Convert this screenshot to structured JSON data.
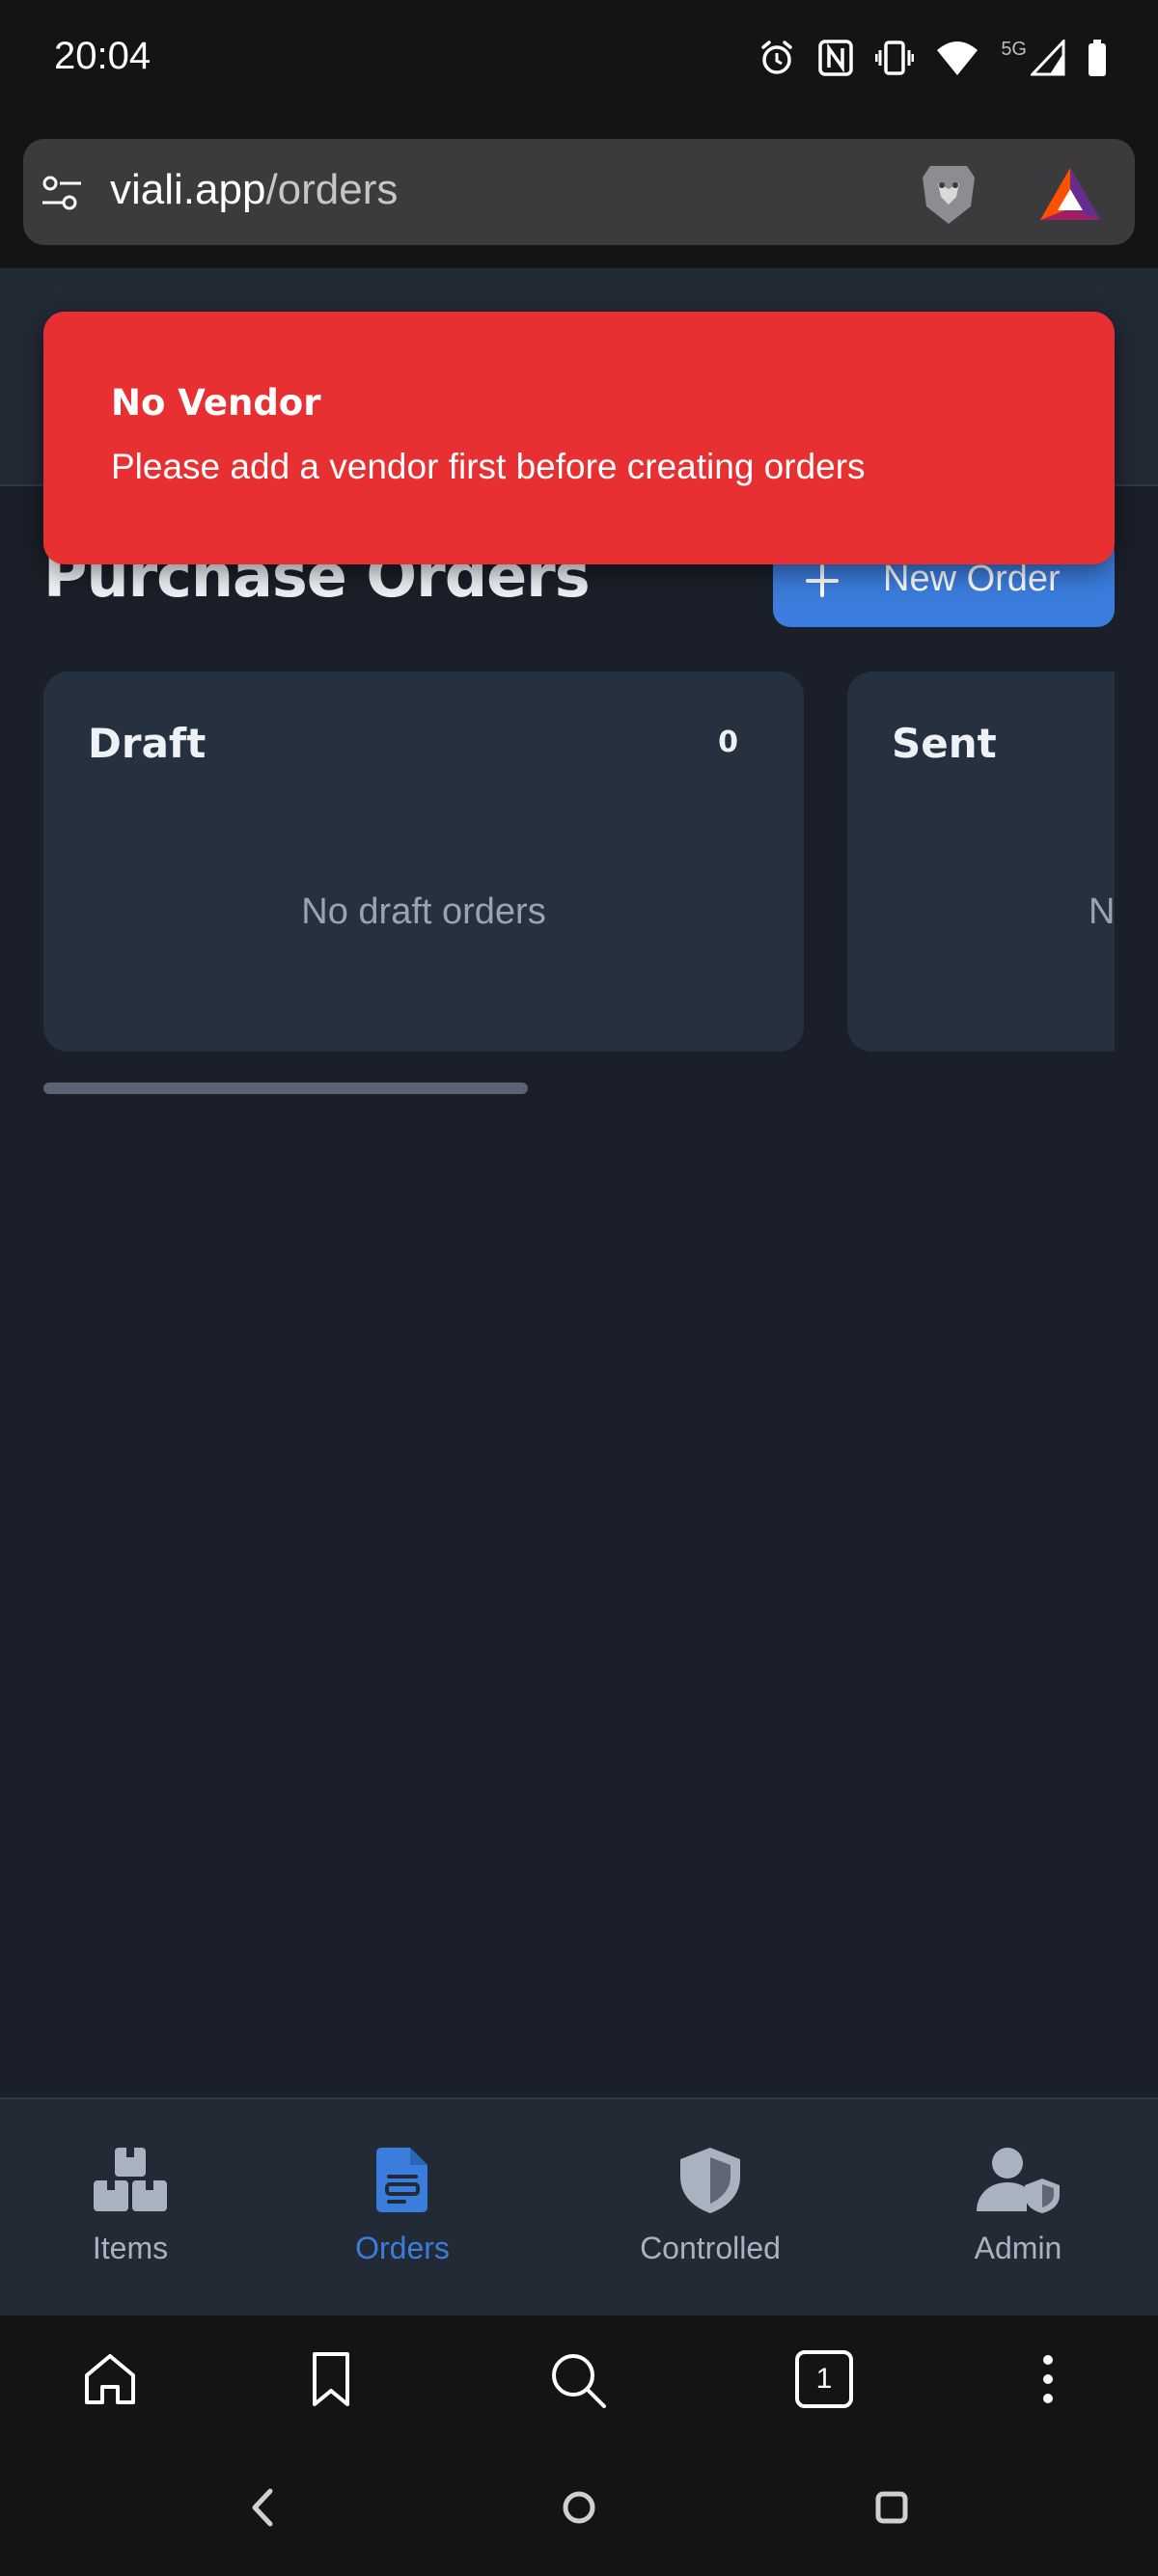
{
  "status_bar": {
    "time": "20:04",
    "network": "5G"
  },
  "browser": {
    "url_domain": "viali.app",
    "url_path": "/orders",
    "tab_count": "1"
  },
  "toast": {
    "title": "No Vendor",
    "message": "Please add a vendor first before creating orders",
    "color": "#e83033"
  },
  "page": {
    "title": "Purchase Orders",
    "new_order_label": "New Order",
    "accent": "#3b7ddd"
  },
  "board": {
    "columns": [
      {
        "title": "Draft",
        "count": "0",
        "empty_text": "No draft orders"
      },
      {
        "title": "Sent",
        "count": "",
        "empty_text": "N"
      }
    ]
  },
  "app_nav": {
    "items": [
      {
        "label": "Items",
        "icon": "boxes-icon",
        "active": false
      },
      {
        "label": "Orders",
        "icon": "file-text-icon",
        "active": true
      },
      {
        "label": "Controlled",
        "icon": "shield-icon",
        "active": false
      },
      {
        "label": "Admin",
        "icon": "user-shield-icon",
        "active": false
      }
    ],
    "active_color": "#3b7ddd",
    "inactive_color": "#a9b2bf"
  },
  "browser_toolbar": {
    "icons": [
      "home-icon",
      "bookmark-icon",
      "search-icon",
      "tabs-icon",
      "more-icon"
    ]
  }
}
